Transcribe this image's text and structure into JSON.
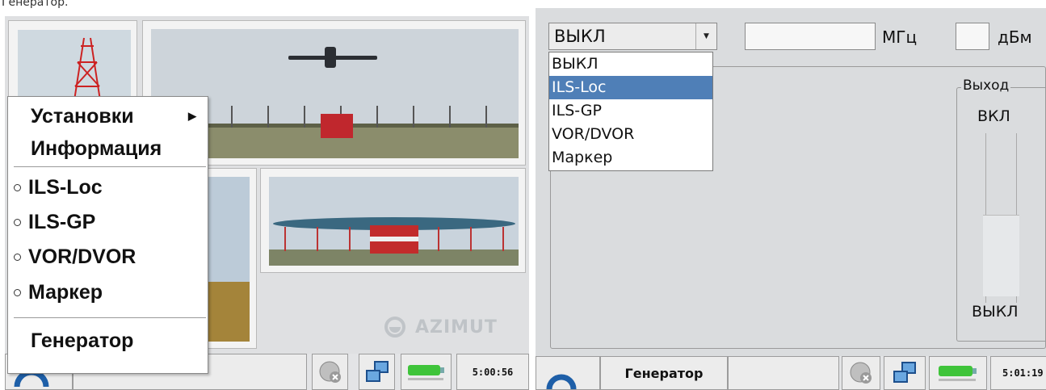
{
  "top_caption": "Генератор.",
  "left": {
    "logo_text": "AZIMUT",
    "menu": {
      "items": [
        {
          "label": "Установки",
          "type": "submenu"
        },
        {
          "label": "Информация",
          "type": "plain"
        },
        {
          "label": "ILS-Loc",
          "type": "radio"
        },
        {
          "label": "ILS-GP",
          "type": "radio"
        },
        {
          "label": "VOR/DVOR",
          "type": "radio"
        },
        {
          "label": "Маркер",
          "type": "radio"
        },
        {
          "label": "Генератор",
          "type": "plain"
        }
      ]
    },
    "status_bar": {
      "time": "5:00:56"
    }
  },
  "right": {
    "mode_select": {
      "value": "ВЫКЛ"
    },
    "frequency": {
      "value": "",
      "unit": "МГц"
    },
    "power": {
      "value": "",
      "unit": "дБм"
    },
    "dropdown_options": [
      "ВЫКЛ",
      "ILS-Loc",
      "ILS-GP",
      "VOR/DVOR",
      "Маркер"
    ],
    "dropdown_selected_index": 1,
    "output": {
      "legend": "Выход",
      "on_label": "ВКЛ",
      "off_label": "ВЫКЛ",
      "level": 0
    },
    "status_bar": {
      "mode_label": "Генератор",
      "time": "5:01:19"
    }
  },
  "colors": {
    "selection": "#4f7fb7",
    "battery": "#3fc43a",
    "logo_blue": "#1e5fa8"
  }
}
